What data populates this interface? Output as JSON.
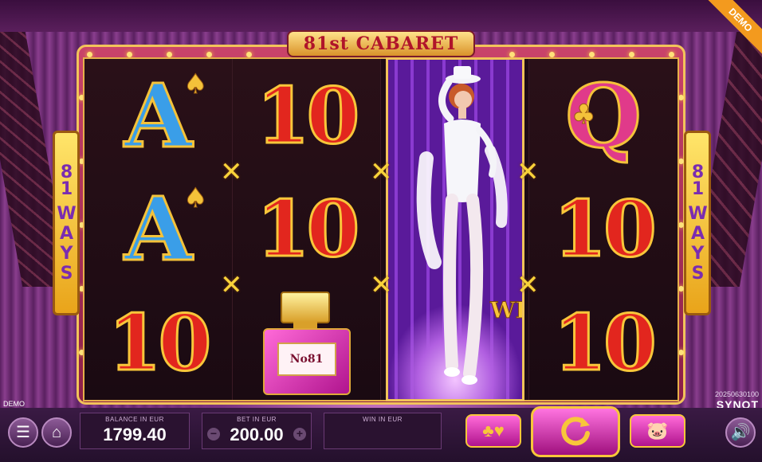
{
  "demo_ribbon": "DEMO",
  "title": "81st CABARET",
  "ways": {
    "number": "81",
    "word": "WAYS"
  },
  "reels": [
    [
      "A",
      "A",
      "10"
    ],
    [
      "10",
      "10",
      "No81"
    ],
    [
      "WILD"
    ],
    [
      "Q",
      "10",
      "10"
    ]
  ],
  "wild_label": "WILD",
  "version": "20250630100",
  "brand": "SYNOT",
  "demo_small": "DEMO",
  "bottom": {
    "balance_label": "BALANCE IN EUR",
    "balance_value": "1799.40",
    "bet_label": "BET IN EUR",
    "bet_value": "200.00",
    "win_label": "WIN IN EUR",
    "win_value": ""
  },
  "icons": {
    "menu": "menu-icon",
    "home": "home-icon",
    "cards": "cards-icon",
    "spin": "spin-icon",
    "piggy": "piggy-bank-icon",
    "sound": "sound-icon"
  },
  "colors": {
    "accent_gold": "#f8c63a",
    "pink": "#e03a8a",
    "ten_red": "#e2261e",
    "ace_blue": "#3a9ee8"
  }
}
